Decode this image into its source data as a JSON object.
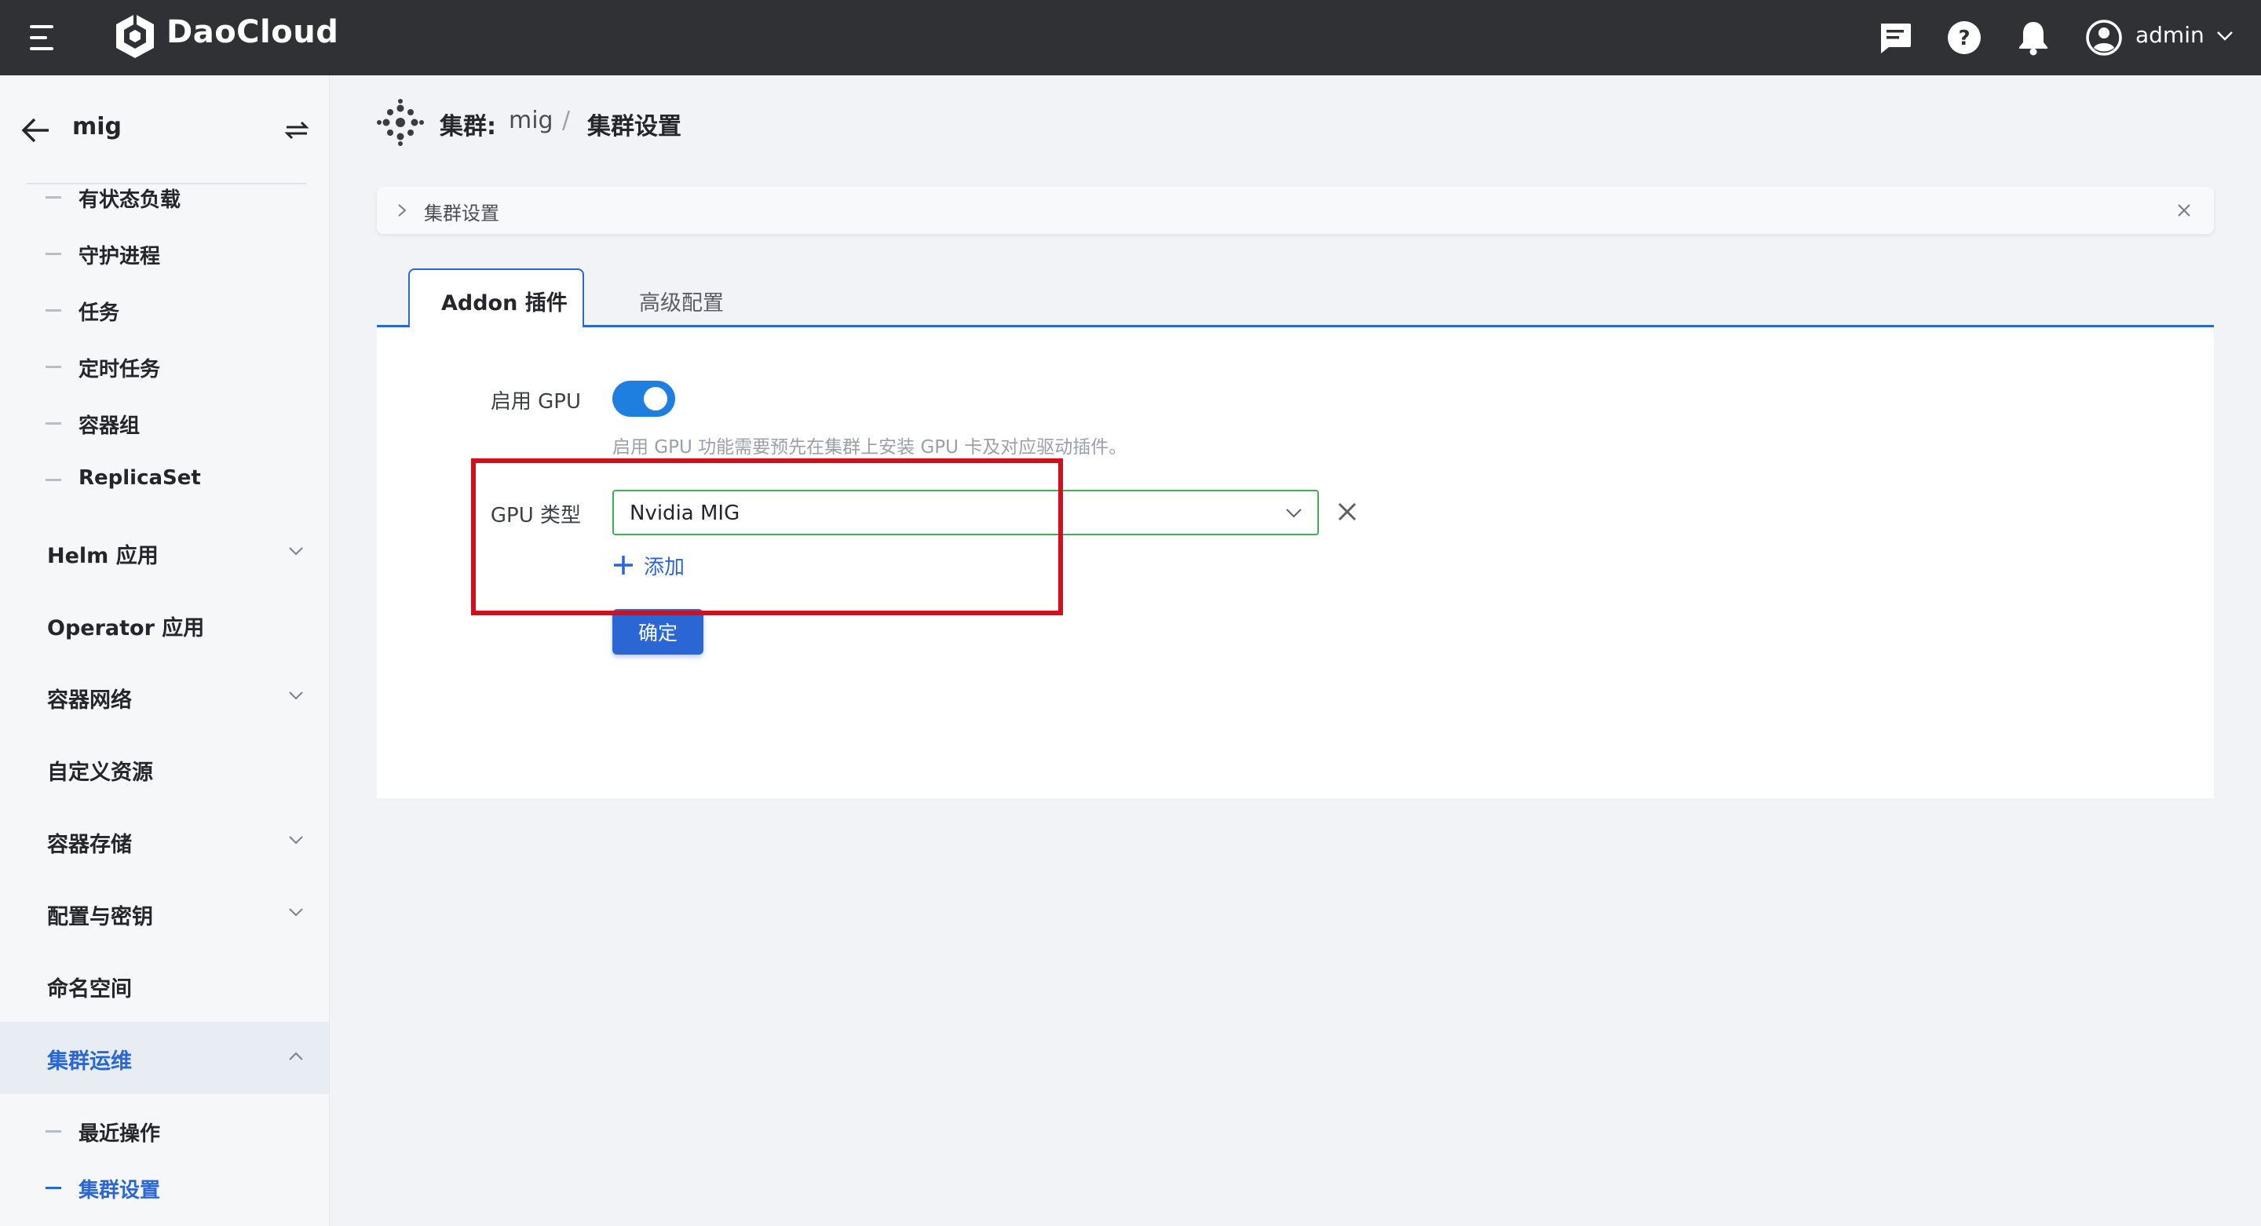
{
  "topbar": {
    "brand": "DaoCloud",
    "user": "admin",
    "icons": [
      "menu-icon",
      "message-icon",
      "help-icon",
      "bell-icon",
      "user-avatar-icon",
      "chevron-down-icon"
    ]
  },
  "sidebar": {
    "title": "mig",
    "sub_items_top": [
      "有状态负载",
      "守护进程",
      "任务",
      "定时任务",
      "容器组",
      "ReplicaSet"
    ],
    "nav": [
      {
        "label": "Helm 应用",
        "expandable": true
      },
      {
        "label": "Operator 应用",
        "expandable": false
      },
      {
        "label": "容器网络",
        "expandable": true
      },
      {
        "label": "自定义资源",
        "expandable": false
      },
      {
        "label": "容器存储",
        "expandable": true
      },
      {
        "label": "配置与密钥",
        "expandable": true
      },
      {
        "label": "命名空间",
        "expandable": false
      },
      {
        "label": "集群运维",
        "expandable": true,
        "active": true
      }
    ],
    "sub_items_bottom": [
      "最近操作",
      "集群设置"
    ],
    "active_item": "集群设置"
  },
  "breadcrumb": {
    "key": "集群:",
    "value": "mig",
    "separator": "/",
    "current": "集群设置"
  },
  "tipbar": {
    "text": "集群设置"
  },
  "tabs": [
    {
      "label": "Addon 插件",
      "active": true
    },
    {
      "label": "高级配置",
      "active": false
    }
  ],
  "form": {
    "gpu_enable_label": "启用 GPU",
    "gpu_enabled": true,
    "gpu_hint": "启用 GPU 功能需要预先在集群上安装 GPU 卡及对应驱动插件。",
    "gpu_type_label": "GPU 类型",
    "gpu_type_value": "Nvidia MIG",
    "add_label": "添加",
    "confirm_label": "确定"
  },
  "colors": {
    "topbar_bg": "#2f3135",
    "primary": "#2a66d4",
    "toggle_on": "#1e7fe0",
    "select_border": "#3fae5a",
    "highlight": "#d0101f"
  }
}
